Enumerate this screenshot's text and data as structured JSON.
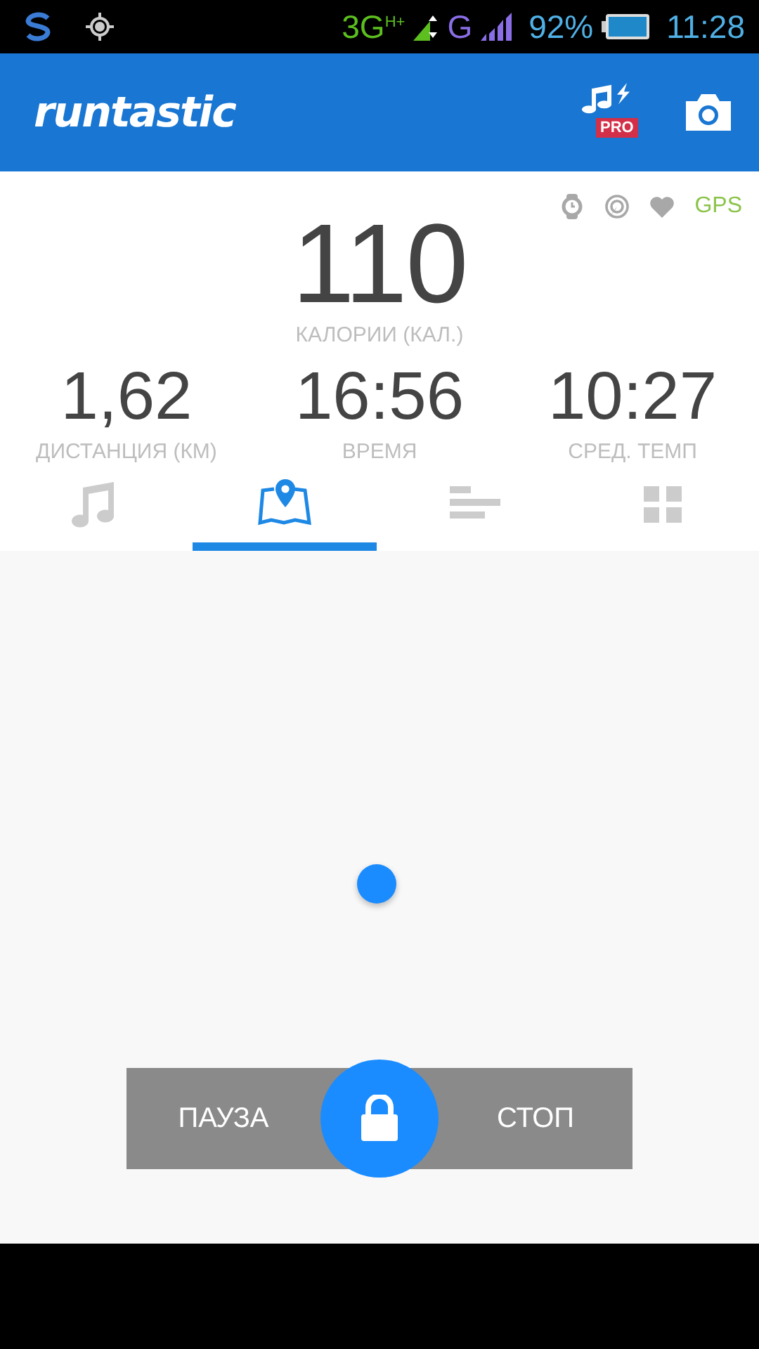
{
  "status_bar": {
    "network": "3G",
    "network_sub": "H+",
    "network2": "G",
    "battery": "92%",
    "time": "11:28"
  },
  "header": {
    "logo": "runtastic",
    "pro_badge": "PRO"
  },
  "sensors": [
    {
      "kind": "watch",
      "active": false
    },
    {
      "kind": "radar",
      "active": false
    },
    {
      "kind": "heart",
      "active": false
    }
  ],
  "gps": {
    "label": "GPS",
    "active": true
  },
  "main_stat": {
    "value": "110",
    "label": "КАЛОРИИ (КАЛ.)"
  },
  "stats": [
    {
      "value": "1,62",
      "label": "ДИСТАНЦИЯ (КМ)"
    },
    {
      "value": "16:56",
      "label": "ВРЕМЯ"
    },
    {
      "value": "10:27",
      "label": "СРЕД. ТЕМП"
    }
  ],
  "tabs": [
    {
      "kind": "music",
      "selected": false
    },
    {
      "kind": "map",
      "selected": true
    },
    {
      "kind": "stats",
      "selected": false
    },
    {
      "kind": "grid",
      "selected": false
    }
  ],
  "controls": {
    "pause": "ПАУЗА",
    "stop": "СТОП"
  }
}
